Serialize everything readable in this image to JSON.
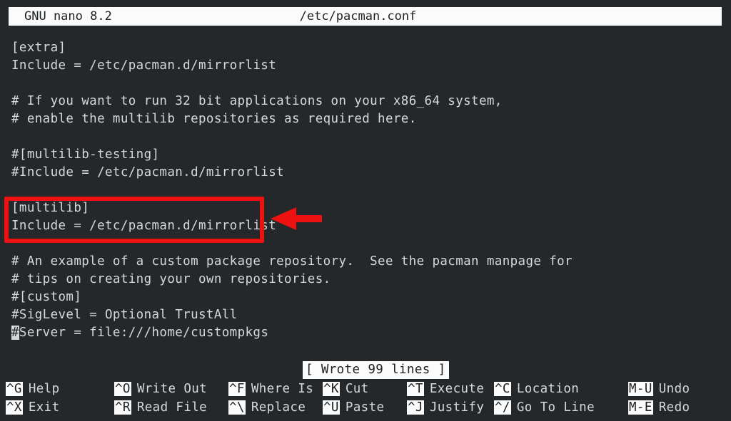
{
  "titlebar": {
    "app": "GNU nano 8.2",
    "filename": "/etc/pacman.conf"
  },
  "editor": {
    "lines": [
      {
        "text": "[extra]"
      },
      {
        "text": "Include = /etc/pacman.d/mirrorlist"
      },
      {
        "text": ""
      },
      {
        "text": "# If you want to run 32 bit applications on your x86_64 system,"
      },
      {
        "text": "# enable the multilib repositories as required here."
      },
      {
        "text": ""
      },
      {
        "text": "#[multilib-testing]"
      },
      {
        "text": "#Include = /etc/pacman.d/mirrorlist"
      },
      {
        "text": ""
      },
      {
        "text": "[multilib]"
      },
      {
        "text": "Include = /etc/pacman.d/mirrorlist"
      },
      {
        "text": ""
      },
      {
        "text": "# An example of a custom package repository.  See the pacman manpage for"
      },
      {
        "text": "# tips on creating your own repositories."
      },
      {
        "text": "#[custom]"
      },
      {
        "text": "#SigLevel = Optional TrustAll"
      },
      {
        "text": "#Server = file:///home/custompkgs",
        "cursor_col": 0
      }
    ]
  },
  "annotation": {
    "highlight_color": "#ee1111",
    "arrow_color": "#ee1111",
    "arrow_direction": "left",
    "highlighted_lines": [
      "[multilib]",
      "Include = /etc/pacman.d/mirrorlist"
    ]
  },
  "status": {
    "message": "[ Wrote 99 lines ]"
  },
  "helpbar": {
    "entries": [
      {
        "key": "^G",
        "label": "Help",
        "col": 0,
        "row": 0
      },
      {
        "key": "^X",
        "label": "Exit",
        "col": 0,
        "row": 1
      },
      {
        "key": "^O",
        "label": "Write Out",
        "col": 1,
        "row": 0
      },
      {
        "key": "^R",
        "label": "Read File",
        "col": 1,
        "row": 1
      },
      {
        "key": "^F",
        "label": "Where Is",
        "col": 2,
        "row": 0
      },
      {
        "key": "^\\",
        "label": "Replace",
        "col": 2,
        "row": 1
      },
      {
        "key": "^K",
        "label": "Cut",
        "col": 3,
        "row": 0
      },
      {
        "key": "^U",
        "label": "Paste",
        "col": 3,
        "row": 1
      },
      {
        "key": "^T",
        "label": "Execute",
        "col": 4,
        "row": 0
      },
      {
        "key": "^J",
        "label": "Justify",
        "col": 4,
        "row": 1
      },
      {
        "key": "^C",
        "label": "Location",
        "col": 5,
        "row": 0
      },
      {
        "key": "^/",
        "label": "Go To Line",
        "col": 5,
        "row": 1
      },
      {
        "key": "M-U",
        "label": "Undo",
        "col": 6,
        "row": 0
      },
      {
        "key": "M-E",
        "label": "Redo",
        "col": 6,
        "row": 1
      }
    ],
    "column_x": [
      8,
      160,
      320,
      452,
      570,
      692,
      880
    ],
    "row_y": [
      0,
      26
    ]
  }
}
